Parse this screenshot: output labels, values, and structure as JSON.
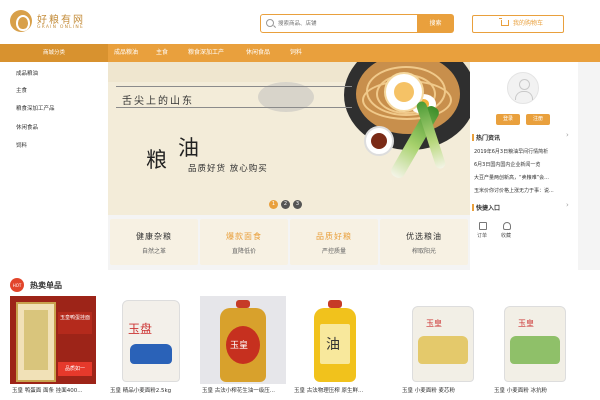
{
  "header": {
    "logo_cn": "好粮有网",
    "logo_en": "GRAIN ONLINE",
    "search_placeholder": "搜索商品、店铺",
    "search_button": "搜索",
    "cart_label": "我的购物车"
  },
  "nav": {
    "category_label": "商城分类",
    "items": [
      "成品粮油",
      "主食",
      "粮食深加工产",
      "休闲食品",
      "饲料"
    ]
  },
  "sidebar": {
    "items": [
      "成品粮油",
      "主食",
      "粮食深加工产品",
      "休闲食品",
      "饲料"
    ]
  },
  "banner": {
    "subtitle": "舌尖上的山东",
    "big_char1": "粮",
    "big_char2": "油",
    "slogan": "品质好货  放心购买",
    "dots": [
      "1",
      "2",
      "3"
    ],
    "active_dot": 0
  },
  "features": [
    {
      "title": "健康杂粮",
      "sub": "自然之革"
    },
    {
      "title": "爆款面食",
      "sub": "直降低价"
    },
    {
      "title": "品质好粮",
      "sub": "严控质量"
    },
    {
      "title": "优选粮油",
      "sub": "榨取阳光"
    }
  ],
  "user_panel": {
    "login_label": "登录",
    "register_label": "注册",
    "news_title": "热门资讯",
    "news": [
      "2019年6月3日粮油早间行情简析",
      "6月3日国内国内企业新闻一览",
      "大豆产量两创新高，“卖粮难”会...",
      "玉米价你讨价格上涨无力于事：说..."
    ],
    "quick_title": "快捷入口",
    "quick_items": [
      "订单",
      "收藏"
    ]
  },
  "hot": {
    "badge": "HOT",
    "title": "热卖单品",
    "products": [
      {
        "name": "玉皇 鸭蛋面 面条 挂面400...",
        "panel_text": "玉皇鸭蛋挂面",
        "sale_text": "品质如一"
      },
      {
        "name": "玉皇 精品小麦面粉2.5kg",
        "label": "玉盘"
      },
      {
        "name": "玉皇 古法小榨花生油一级压...",
        "label": "玉皇"
      },
      {
        "name": "玉皇 古法物理压榨 原生鲜...",
        "label": "油"
      },
      {
        "name": "玉皇 小麦面粉 麦芯粉",
        "label": "玉皇"
      },
      {
        "name": "玉皇 小麦面粉 冰抗粉",
        "label": "玉皇"
      }
    ]
  },
  "colors": {
    "accent": "#e9a03d",
    "hot_red": "#e2452b"
  }
}
